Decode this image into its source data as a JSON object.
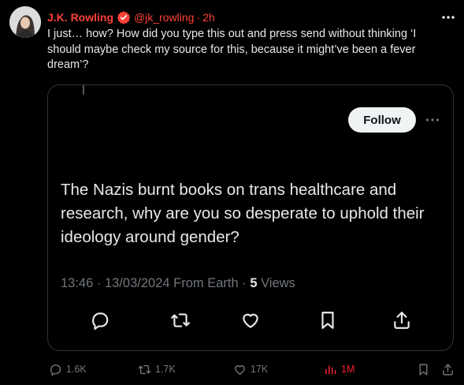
{
  "tweet": {
    "author_name": "J.K. Rowling",
    "handle": "@jk_rowling",
    "separator": "·",
    "time": "2h",
    "text": "I just… how? How did you type this out and press send without thinking ‘I should maybe check my source for this, because it might’ve been a fever dream’?"
  },
  "quoted": {
    "follow_label": "Follow",
    "text": "The Nazis burnt books on trans healthcare and research, why are you so desperate to uphold their ideology around gender?",
    "timestamp": "13:46 · 13/03/2024 From Earth ·",
    "views_count": "5",
    "views_label": "Views"
  },
  "actions": {
    "replies": "1.6K",
    "reposts": "1.7K",
    "likes": "17K",
    "views": "1M"
  },
  "colors": {
    "name_accent": "#ff4136",
    "views_accent": "#f4212e",
    "background": "#000000",
    "text": "#e7e9ea",
    "muted": "#71767b"
  },
  "icons": [
    "verified-badge-icon",
    "more-icon",
    "reply-icon",
    "repost-icon",
    "like-icon",
    "bookmark-icon",
    "share-icon",
    "views-icon"
  ]
}
